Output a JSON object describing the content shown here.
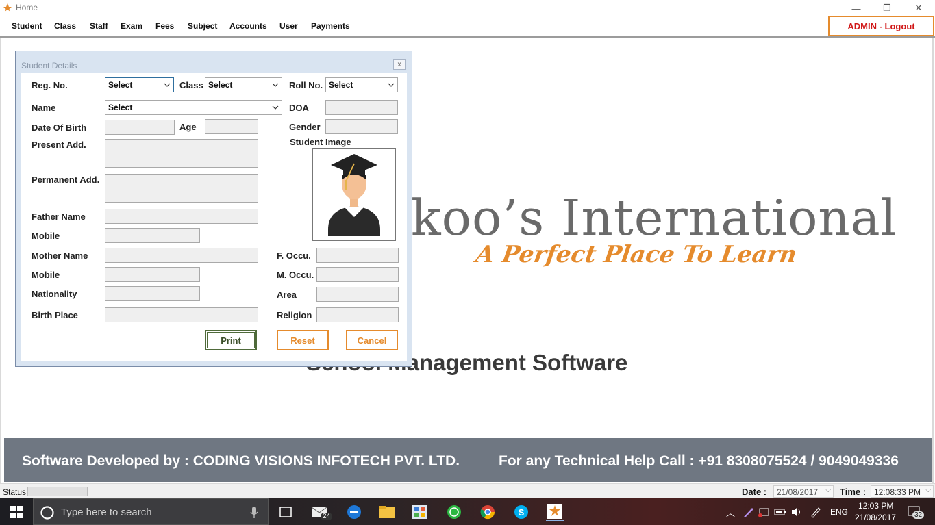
{
  "window": {
    "title": "Home",
    "minimize": "—",
    "restore": "❐",
    "close": "✕"
  },
  "menu": {
    "items": [
      "Student",
      "Class",
      "Staff",
      "Exam",
      "Fees",
      "Subject",
      "Accounts",
      "User",
      "Payments"
    ],
    "logout_label": "ADMIN - Logout"
  },
  "background": {
    "logo_title": "koo’s International",
    "tagline": "A Perfect Place To Learn",
    "subtitle": "School Management Software"
  },
  "footer": {
    "developer": "Software Developed by : CODING VISIONS INFOTECH PVT. LTD.",
    "help": "For any Technical Help Call : +91 8308075524 / 9049049336"
  },
  "statusbar": {
    "status_label": "Status",
    "date_label": "Date :",
    "date_value": "21/08/2017",
    "time_label": "Time :",
    "time_value": "12:08:33 PM"
  },
  "dialog": {
    "title": "Student Details",
    "close": "x",
    "labels": {
      "reg_no": "Reg. No.",
      "class": "Class",
      "roll_no": "Roll No.",
      "name": "Name",
      "doa": "DOA",
      "dob": "Date Of Birth",
      "age": "Age",
      "gender": "Gender",
      "present_add": "Present Add.",
      "student_image": "Student Image",
      "permanent_add": "Permanent Add.",
      "father_name": "Father Name",
      "mobile1": "Mobile",
      "mother_name": "Mother Name",
      "f_occu": "F. Occu.",
      "mobile2": "Mobile",
      "m_occu": "M. Occu.",
      "nationality": "Nationality",
      "area": "Area",
      "birth_place": "Birth Place",
      "religion": "Religion"
    },
    "selects": {
      "reg_no": "Select",
      "class": "Select",
      "roll_no": "Select",
      "name": "Select"
    },
    "buttons": {
      "print": "Print",
      "reset": "Reset",
      "cancel": "Cancel"
    }
  },
  "taskbar": {
    "search_placeholder": "Type here to search",
    "mail_badge": "24",
    "lang": "ENG",
    "clock_time": "12:03 PM",
    "clock_date": "21/08/2017",
    "notif_count": "32"
  },
  "colors": {
    "accent_orange": "#e58b2d",
    "logout_red": "#d01818",
    "footer_bg": "#6f7782",
    "print_green": "#4f6a3a"
  }
}
